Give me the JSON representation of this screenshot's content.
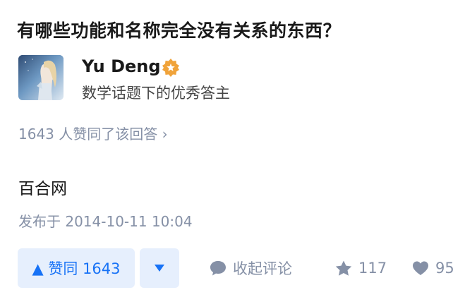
{
  "question": {
    "title": "有哪些功能和名称完全没有关系的东西？"
  },
  "author": {
    "name": "Yu Deng",
    "description": "数学话题下的优秀答主",
    "badge_icon": "orange-star-badge-icon"
  },
  "vote_summary": "1643 人赞同了该回答 ›",
  "answer": {
    "content": "百合网",
    "publish_time": "发布于 2014-10-11 10:04"
  },
  "actions": {
    "upvote_label": "▲ 赞同 1643",
    "downvote_icon": "triangle-down-icon",
    "comment_label": "收起评论",
    "favorite_count": "117",
    "like_count": "95"
  },
  "colors": {
    "accent": "#1772f6",
    "accent_bg": "#e6effd",
    "muted": "#8590a6",
    "badge": "#f0a33a"
  }
}
